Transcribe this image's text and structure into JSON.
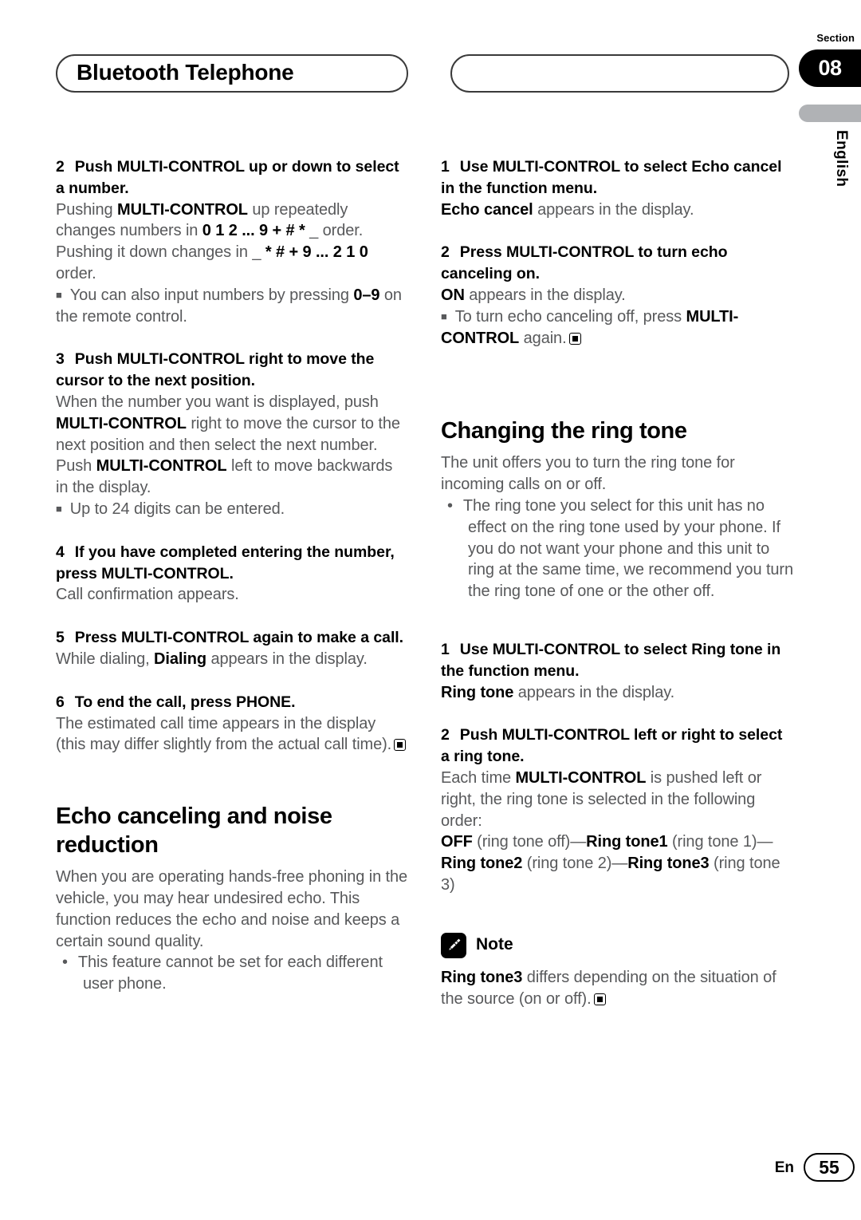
{
  "header": {
    "chapter_title": "Bluetooth Telephone",
    "topic_title": "",
    "section_label": "Section",
    "section_number": "08",
    "language": "English"
  },
  "footer": {
    "language_code": "En",
    "page_number": "55"
  },
  "colors": {
    "body_text": "#58595b",
    "heading_text": "#000000",
    "badge_background": "#000000",
    "language_bar": "#b0b2b5"
  },
  "left_column": {
    "step2": {
      "number": "2",
      "heading": "Push MULTI-CONTROL up or down to select a number.",
      "body_1a": "Pushing ",
      "body_1b": "MULTI-CONTROL",
      "body_1c": " up repeatedly changes numbers in ",
      "body_1d": "0 1 2 ... 9 + # *",
      "body_1e": " _ order. Pushing it down changes in _ ",
      "body_1f": "* # + 9 ... 2 1 0",
      "body_1g": " order.",
      "bullet_1a": "You can also input numbers by pressing ",
      "bullet_1b": "0–9",
      "bullet_1c": " on the remote control."
    },
    "step3": {
      "number": "3",
      "heading": "Push MULTI-CONTROL right to move the cursor to the next position.",
      "body_1a": "When the number you want is displayed, push ",
      "body_1b": "MULTI-CONTROL",
      "body_1c": " right to move the cursor to the next position and then select the next number. Push ",
      "body_1d": "MULTI-CONTROL",
      "body_1e": " left to move backwards in the display.",
      "bullet_1": "Up to 24 digits can be entered."
    },
    "step4": {
      "number": "4",
      "heading": "If you have completed entering the number, press MULTI-CONTROL.",
      "body_1": "Call confirmation appears."
    },
    "step5": {
      "number": "5",
      "heading": "Press MULTI-CONTROL again to make a call.",
      "body_1a": "While dialing, ",
      "body_1b": "Dialing",
      "body_1c": " appears in the display."
    },
    "step6": {
      "number": "6",
      "heading": "To end the call, press PHONE.",
      "body_1": "The estimated call time appears in the display (this may differ slightly from the actual call time)."
    },
    "echo_section": {
      "heading": "Echo canceling and noise reduction",
      "body_1": "When you are operating hands-free phoning in the vehicle, you may hear undesired echo. This function reduces the echo and noise and keeps a certain sound quality.",
      "bullet_1": "This feature cannot be set for each different user phone."
    }
  },
  "right_column": {
    "echo_step1": {
      "number": "1",
      "heading": "Use MULTI-CONTROL to select Echo cancel in the function menu.",
      "body_1a": "Echo cancel",
      "body_1b": " appears in the display."
    },
    "echo_step2": {
      "number": "2",
      "heading": "Press MULTI-CONTROL to turn echo canceling on.",
      "body_1a": "ON",
      "body_1b": " appears in the display.",
      "bullet_1a": "To turn echo canceling off, press ",
      "bullet_1b": "MULTI-CONTROL",
      "bullet_1c": " again."
    },
    "ringtone_section": {
      "heading": "Changing the ring tone",
      "body_1": "The unit offers you to turn the ring tone for incoming calls on or off.",
      "bullet_1": "The ring tone you select for this unit has no effect on the ring tone used by your phone. If you do not want your phone and this unit to ring at the same time, we recommend you turn the ring tone of one or the other off."
    },
    "ringtone_step1": {
      "number": "1",
      "heading": "Use MULTI-CONTROL to select Ring tone in the function menu.",
      "body_1a": "Ring tone",
      "body_1b": " appears in the display."
    },
    "ringtone_step2": {
      "number": "2",
      "heading": "Push MULTI-CONTROL left or right to select a ring tone.",
      "body_1a": "Each time ",
      "body_1b": "MULTI-CONTROL",
      "body_1c": " is pushed left or right, the ring tone is selected in the following order:",
      "order_1a": "OFF",
      "order_1b": " (ring tone off)—",
      "order_1c": "Ring tone1",
      "order_1d": " (ring tone 1)—",
      "order_1e": "Ring tone2",
      "order_1f": " (ring tone 2)—",
      "order_1g": "Ring tone3",
      "order_1h": " (ring tone 3)"
    },
    "note": {
      "label": "Note",
      "body_1a": "Ring tone3",
      "body_1b": " differs depending on the situation of the source (on or off)."
    }
  }
}
